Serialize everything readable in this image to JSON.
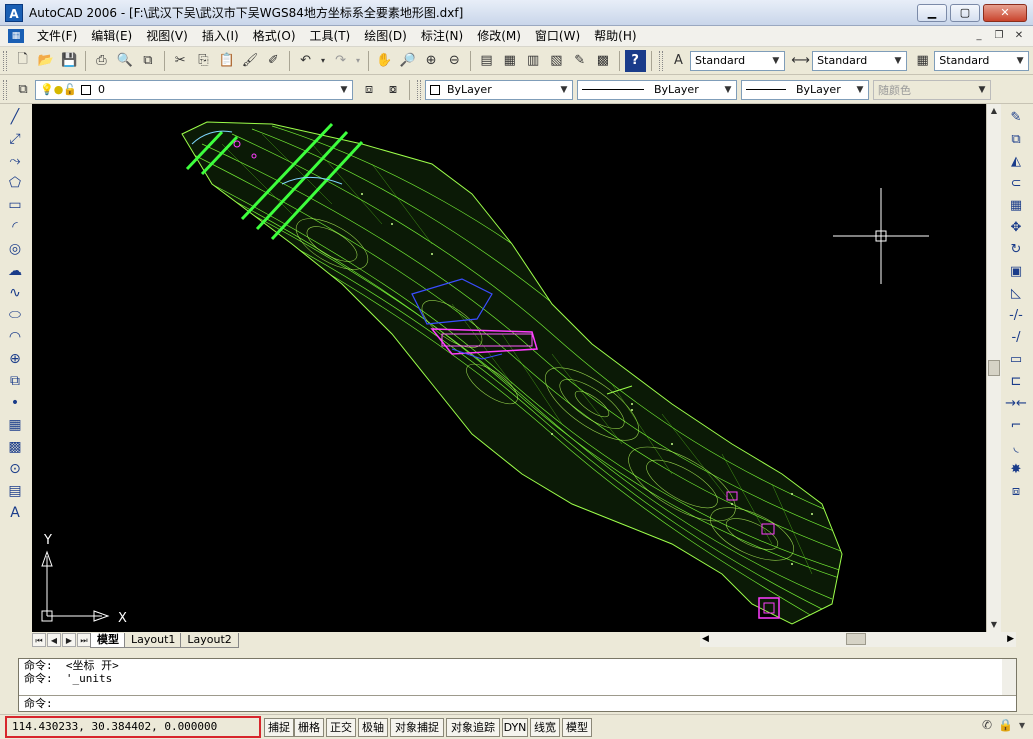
{
  "window": {
    "title": "AutoCAD 2006 - [F:\\武汉下吴\\武汉市下吴WGS84地方坐标系全要素地形图.dxf]",
    "app_logo": "A",
    "buttons": [
      "minimize-icon",
      "maximize-icon",
      "close-icon"
    ]
  },
  "menu": {
    "items": [
      "文件(F)",
      "编辑(E)",
      "视图(V)",
      "插入(I)",
      "格式(O)",
      "工具(T)",
      "绘图(D)",
      "标注(N)",
      "修改(M)",
      "窗口(W)",
      "帮助(H)"
    ]
  },
  "toolbar_standard": {
    "text_style": "Standard",
    "dim_style": "Standard",
    "table_style": "Standard"
  },
  "toolbar_layers": {
    "current_layer": "0",
    "color": "ByLayer",
    "linetype": "ByLayer",
    "lineweight": "ByLayer",
    "plot_style": "随颜色"
  },
  "left_tools": [
    "line-icon",
    "construction-line-icon",
    "polyline-icon",
    "polygon-icon",
    "rectangle-icon",
    "arc-icon",
    "circle-icon",
    "revision-cloud-icon",
    "spline-icon",
    "ellipse-icon",
    "ellipse-arc-icon",
    "insert-block-icon",
    "make-block-icon",
    "point-icon",
    "hatch-icon",
    "gradient-icon",
    "region-icon",
    "table-icon",
    "multiline-text-icon"
  ],
  "left_tool_glyphs": [
    "╱",
    "⤢",
    "⤳",
    "⬠",
    "▭",
    "◜",
    "◎",
    "☁",
    "∿",
    "⬭",
    "◠",
    "⊕",
    "⧉",
    "•",
    "▦",
    "▩",
    "⊙",
    "▤",
    "A"
  ],
  "right_tools": [
    "erase-icon",
    "copy-icon",
    "mirror-icon",
    "offset-icon",
    "array-icon",
    "move-icon",
    "rotate-icon",
    "scale-icon",
    "stretch-icon",
    "trim-icon",
    "extend-icon",
    "break-at-point-icon",
    "break-icon",
    "join-icon",
    "chamfer-icon",
    "fillet-icon",
    "explode-icon",
    "draw-order-icon"
  ],
  "right_tool_glyphs": [
    "✎",
    "⧉",
    "◭",
    "⊂",
    "▦",
    "✥",
    "↻",
    "▣",
    "◺",
    "-/-",
    "-/",
    "▭",
    "⊏",
    "→←",
    "⌐",
    "◟",
    "✸",
    "⧈"
  ],
  "canvas": {
    "ucs": {
      "x_label": "X",
      "y_label": "Y"
    }
  },
  "layout_tabs": [
    "模型",
    "Layout1",
    "Layout2"
  ],
  "command": {
    "history": [
      "命令:  <坐标 开>",
      "命令:  '_units"
    ],
    "prompt": "命令:"
  },
  "status": {
    "coordinates": "114.430233,  30.384402,  0.000000",
    "buttons": [
      "捕捉",
      "栅格",
      "正交",
      "极轴",
      "对象捕捉",
      "对象追踪",
      "DYN",
      "线宽",
      "模型"
    ]
  }
}
